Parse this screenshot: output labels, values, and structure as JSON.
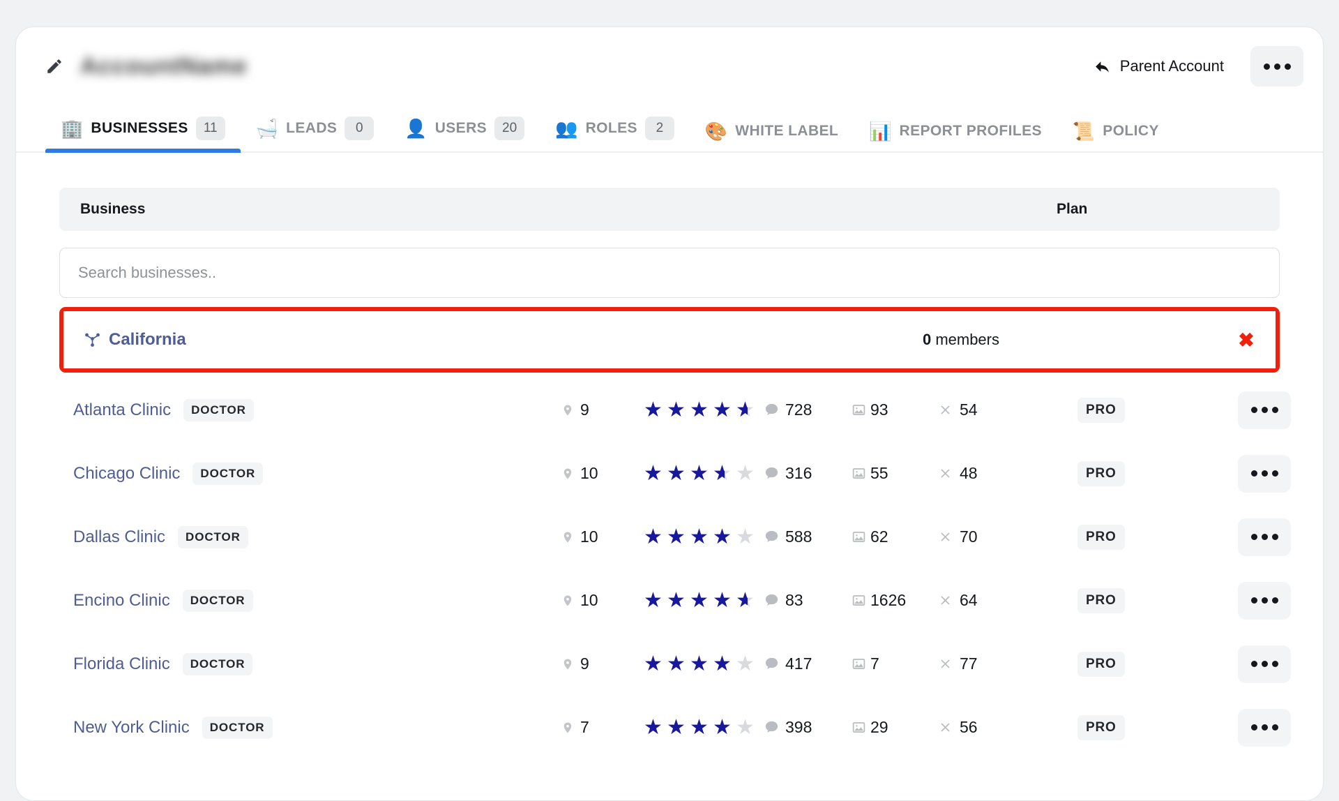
{
  "header": {
    "edit_icon": "pencil-icon",
    "account_name": "AccountName",
    "parent_account_label": "Parent Account",
    "back_icon": "reply-arrow-icon",
    "kebab_label": "•••"
  },
  "tabs": [
    {
      "label": "BUSINESSES",
      "badge": "11",
      "icon": "🏢",
      "icon_name": "office-building-icon",
      "active": true
    },
    {
      "label": "LEADS",
      "badge": "0",
      "icon": "🛁",
      "icon_name": "funnel-leads-icon",
      "active": false
    },
    {
      "label": "USERS",
      "badge": "20",
      "icon": "👤",
      "icon_name": "user-icon",
      "active": false
    },
    {
      "label": "ROLES",
      "badge": "2",
      "icon": "👥",
      "icon_name": "people-roles-icon",
      "active": false
    },
    {
      "label": "WHITE LABEL",
      "badge": "",
      "icon": "🎨",
      "icon_name": "palette-icon",
      "active": false
    },
    {
      "label": "REPORT PROFILES",
      "badge": "",
      "icon": "📊",
      "icon_name": "report-chart-icon",
      "active": false
    },
    {
      "label": "POLICY",
      "badge": "",
      "icon": "📜",
      "icon_name": "policy-scroll-icon",
      "active": false
    }
  ],
  "table": {
    "columns": {
      "business": "Business",
      "plan": "Plan"
    },
    "search": {
      "placeholder": "Search businesses..",
      "value": ""
    },
    "group": {
      "name": "California",
      "icon_name": "sitemap-tree-icon",
      "members_count": "0",
      "members_label": "members",
      "remove_icon": "✖",
      "highlight_color": "#f21f0c"
    },
    "rows": [
      {
        "name": "Atlanta Clinic",
        "role": "DOCTOR",
        "locations": "9",
        "rating": 4.5,
        "reviews": "728",
        "photos": "93",
        "errors": "54",
        "plan": "PRO"
      },
      {
        "name": "Chicago Clinic",
        "role": "DOCTOR",
        "locations": "10",
        "rating": 3.5,
        "reviews": "316",
        "photos": "55",
        "errors": "48",
        "plan": "PRO"
      },
      {
        "name": "Dallas Clinic",
        "role": "DOCTOR",
        "locations": "10",
        "rating": 4.0,
        "reviews": "588",
        "photos": "62",
        "errors": "70",
        "plan": "PRO"
      },
      {
        "name": "Encino Clinic",
        "role": "DOCTOR",
        "locations": "10",
        "rating": 4.5,
        "reviews": "83",
        "photos": "1626",
        "errors": "64",
        "plan": "PRO"
      },
      {
        "name": "Florida Clinic",
        "role": "DOCTOR",
        "locations": "9",
        "rating": 4.0,
        "reviews": "417",
        "photos": "7",
        "errors": "77",
        "plan": "PRO"
      },
      {
        "name": "New York Clinic",
        "role": "DOCTOR",
        "locations": "7",
        "rating": 4.0,
        "reviews": "398",
        "photos": "29",
        "errors": "56",
        "plan": "PRO"
      }
    ]
  },
  "colors": {
    "accent_blue": "#2c7be5",
    "link_slate": "#4e5d94",
    "star_blue": "#17189c",
    "highlight_red": "#f21f0c",
    "page_bg": "#f1f2f4"
  }
}
